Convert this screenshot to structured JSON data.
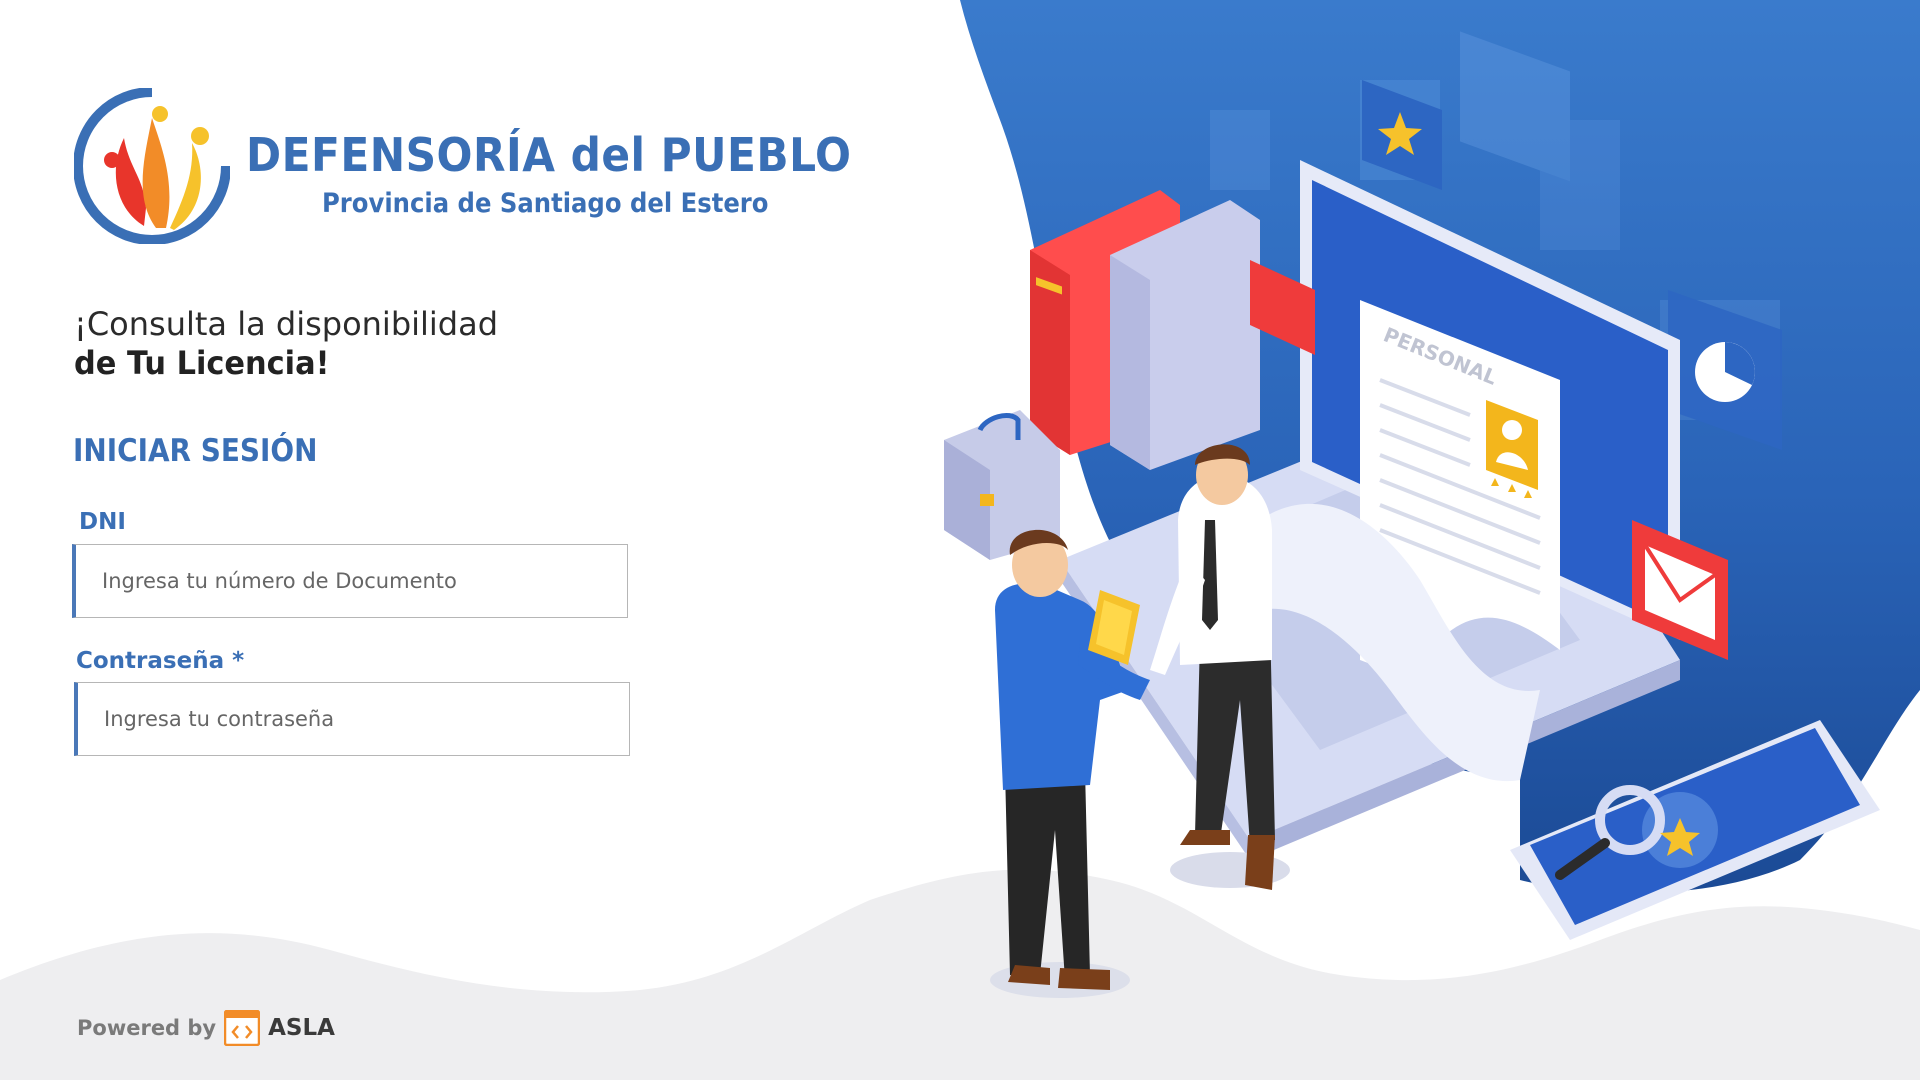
{
  "brand": {
    "title": "DEFENSORÍA del PUEBLO",
    "subtitle": "Provincia de Santiago del Estero"
  },
  "tagline": {
    "line1": "¡Consulta la disponibilidad",
    "line2": "de Tu Licencia!"
  },
  "login": {
    "title": "INICIAR SESIÓN",
    "dni_label": "DNI",
    "dni_placeholder": "Ingresa tu número de Documento",
    "password_label": "Contraseña *",
    "password_placeholder": "Ingresa tu contraseña"
  },
  "footer": {
    "powered_label": "Powered by",
    "vendor": "ASLA"
  },
  "illustration": {
    "document_label": "PERSONAL"
  },
  "colors": {
    "brand_blue": "#3a6fb5",
    "hero_blue_dark": "#1c4f9c",
    "hero_blue_light": "#3b7fd0",
    "footer_gray": "#eeeef0",
    "asla_orange": "#f28c28"
  }
}
